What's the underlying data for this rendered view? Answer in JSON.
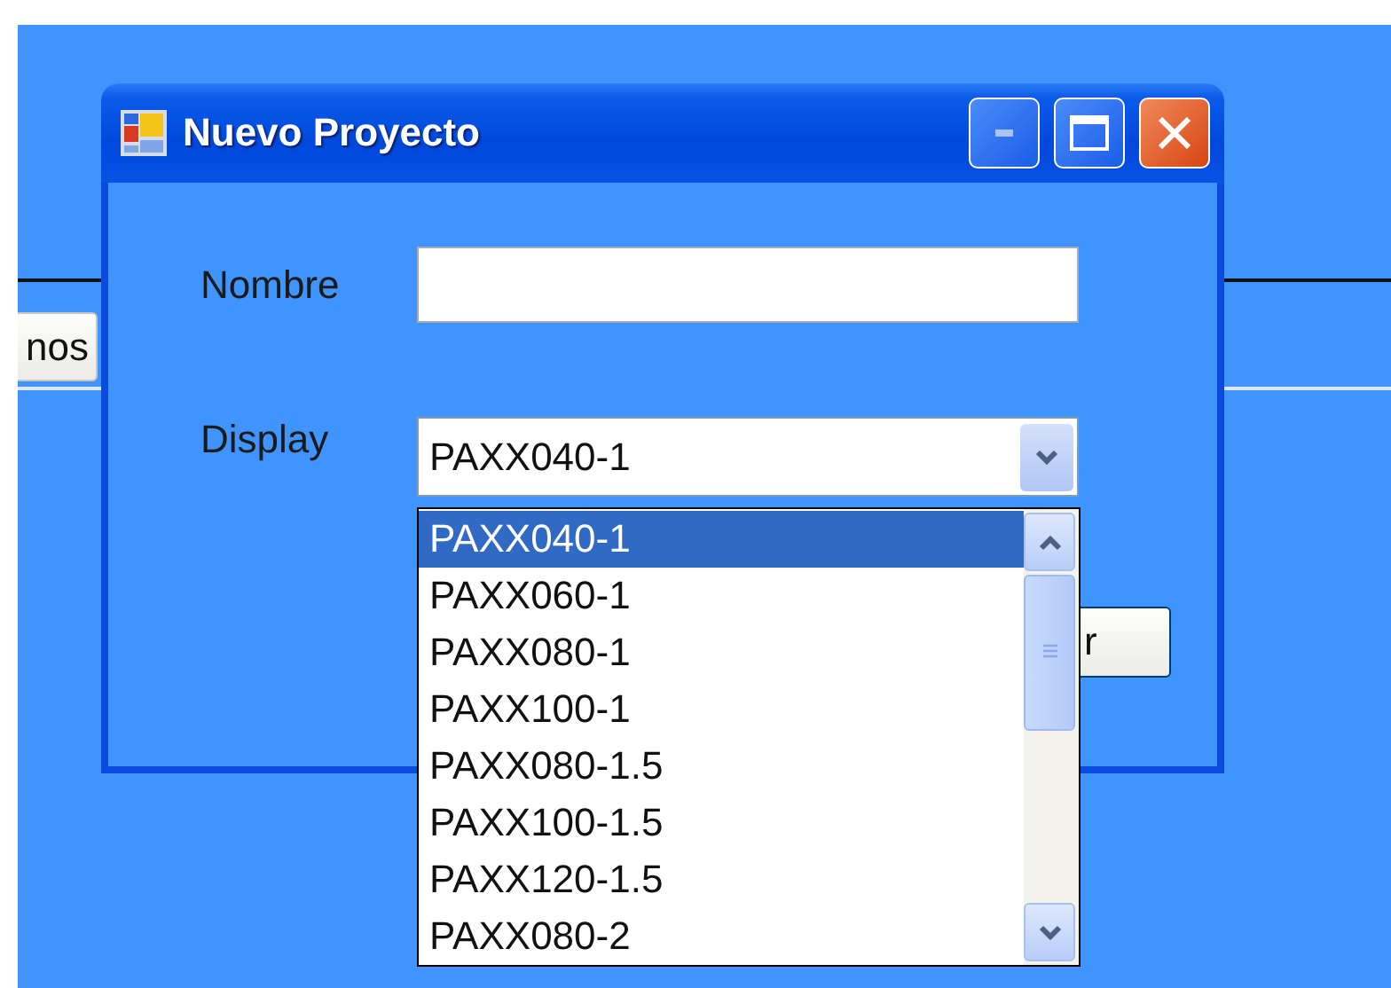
{
  "background": {
    "buttons": [
      {
        "label": "nos"
      }
    ]
  },
  "dialog": {
    "title": "Nuevo Proyecto",
    "nombre": {
      "label": "Nombre"
    },
    "display": {
      "label": "Display",
      "value": "PAXX040-1",
      "expanded": true,
      "options": [
        {
          "label": "PAXX040-1",
          "selected": true
        },
        {
          "label": "PAXX060-1",
          "selected": false
        },
        {
          "label": "PAXX080-1",
          "selected": false
        },
        {
          "label": "PAXX100-1",
          "selected": false
        },
        {
          "label": "PAXX080-1.5",
          "selected": false
        },
        {
          "label": "PAXX100-1.5",
          "selected": false
        },
        {
          "label": "PAXX120-1.5",
          "selected": false
        },
        {
          "label": "PAXX080-2",
          "selected": false
        }
      ]
    },
    "buttons": [
      {
        "label": "r"
      }
    ]
  }
}
